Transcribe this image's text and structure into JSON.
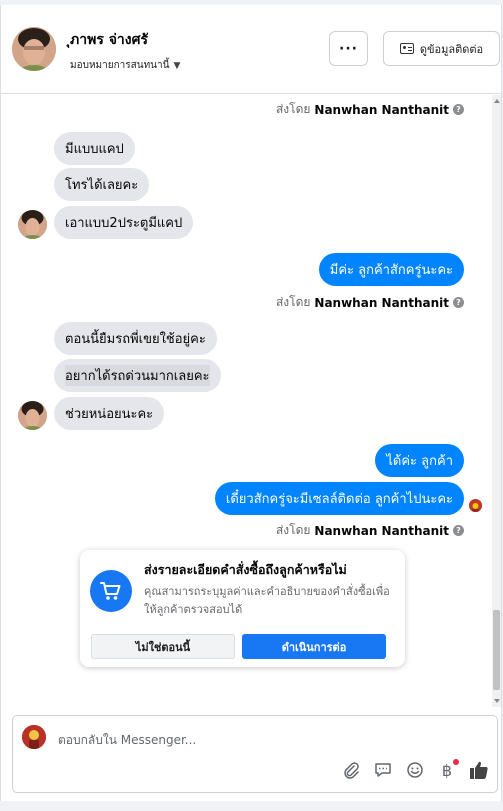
{
  "header": {
    "customer_name": "ุภาพร จ่างศรั",
    "assign_label": "มอบหมายการสนทนานี้",
    "more_button": "···",
    "contact_button": "ดูข้อมูลติดต่อ"
  },
  "messages": {
    "sent_by_prefix": "ส่งโดย",
    "agent_name": "Nanwhan Nanthanit",
    "in_1": "มีแบบแคป",
    "in_2": "โทรได้เลยคะ",
    "in_3": "เอาแบบ2ประตูมีแคป",
    "out_1": "มีค่ะ ลูกค้าสักครู่นะคะ",
    "in_4": "ตอนนี้ยืมรถพี่เขยใช้อยู่คะ",
    "in_5": "อยากได้รถด่วนมากเลยคะ",
    "in_6": "ช่วยหน่อยนะคะ",
    "out_2": "ได้ค่ะ ลูกค้า",
    "out_3": "เดี๋ยวสักครู่จะมีเซลล์ติดต่อ ลูกค้าไปนะคะ"
  },
  "order_card": {
    "title": "ส่งรายละเอียดคำสั่งซื้อถึงลูกค้าหรือไม่",
    "body": "คุณสามารถระบุมูลค่าและคำอธิบายของคำสั่งซื้อเพื่อให้ลูกค้าตรวจสอบได้",
    "dismiss_button": "ไม่ใช่ตอนนี้",
    "continue_button": "ดำเนินการต่อ"
  },
  "composer": {
    "placeholder": "ตอบกลับใน Messenger..."
  },
  "colors": {
    "accent": "#0084ff",
    "brand": "#1877f2",
    "bubble_in": "#e4e6eb"
  }
}
